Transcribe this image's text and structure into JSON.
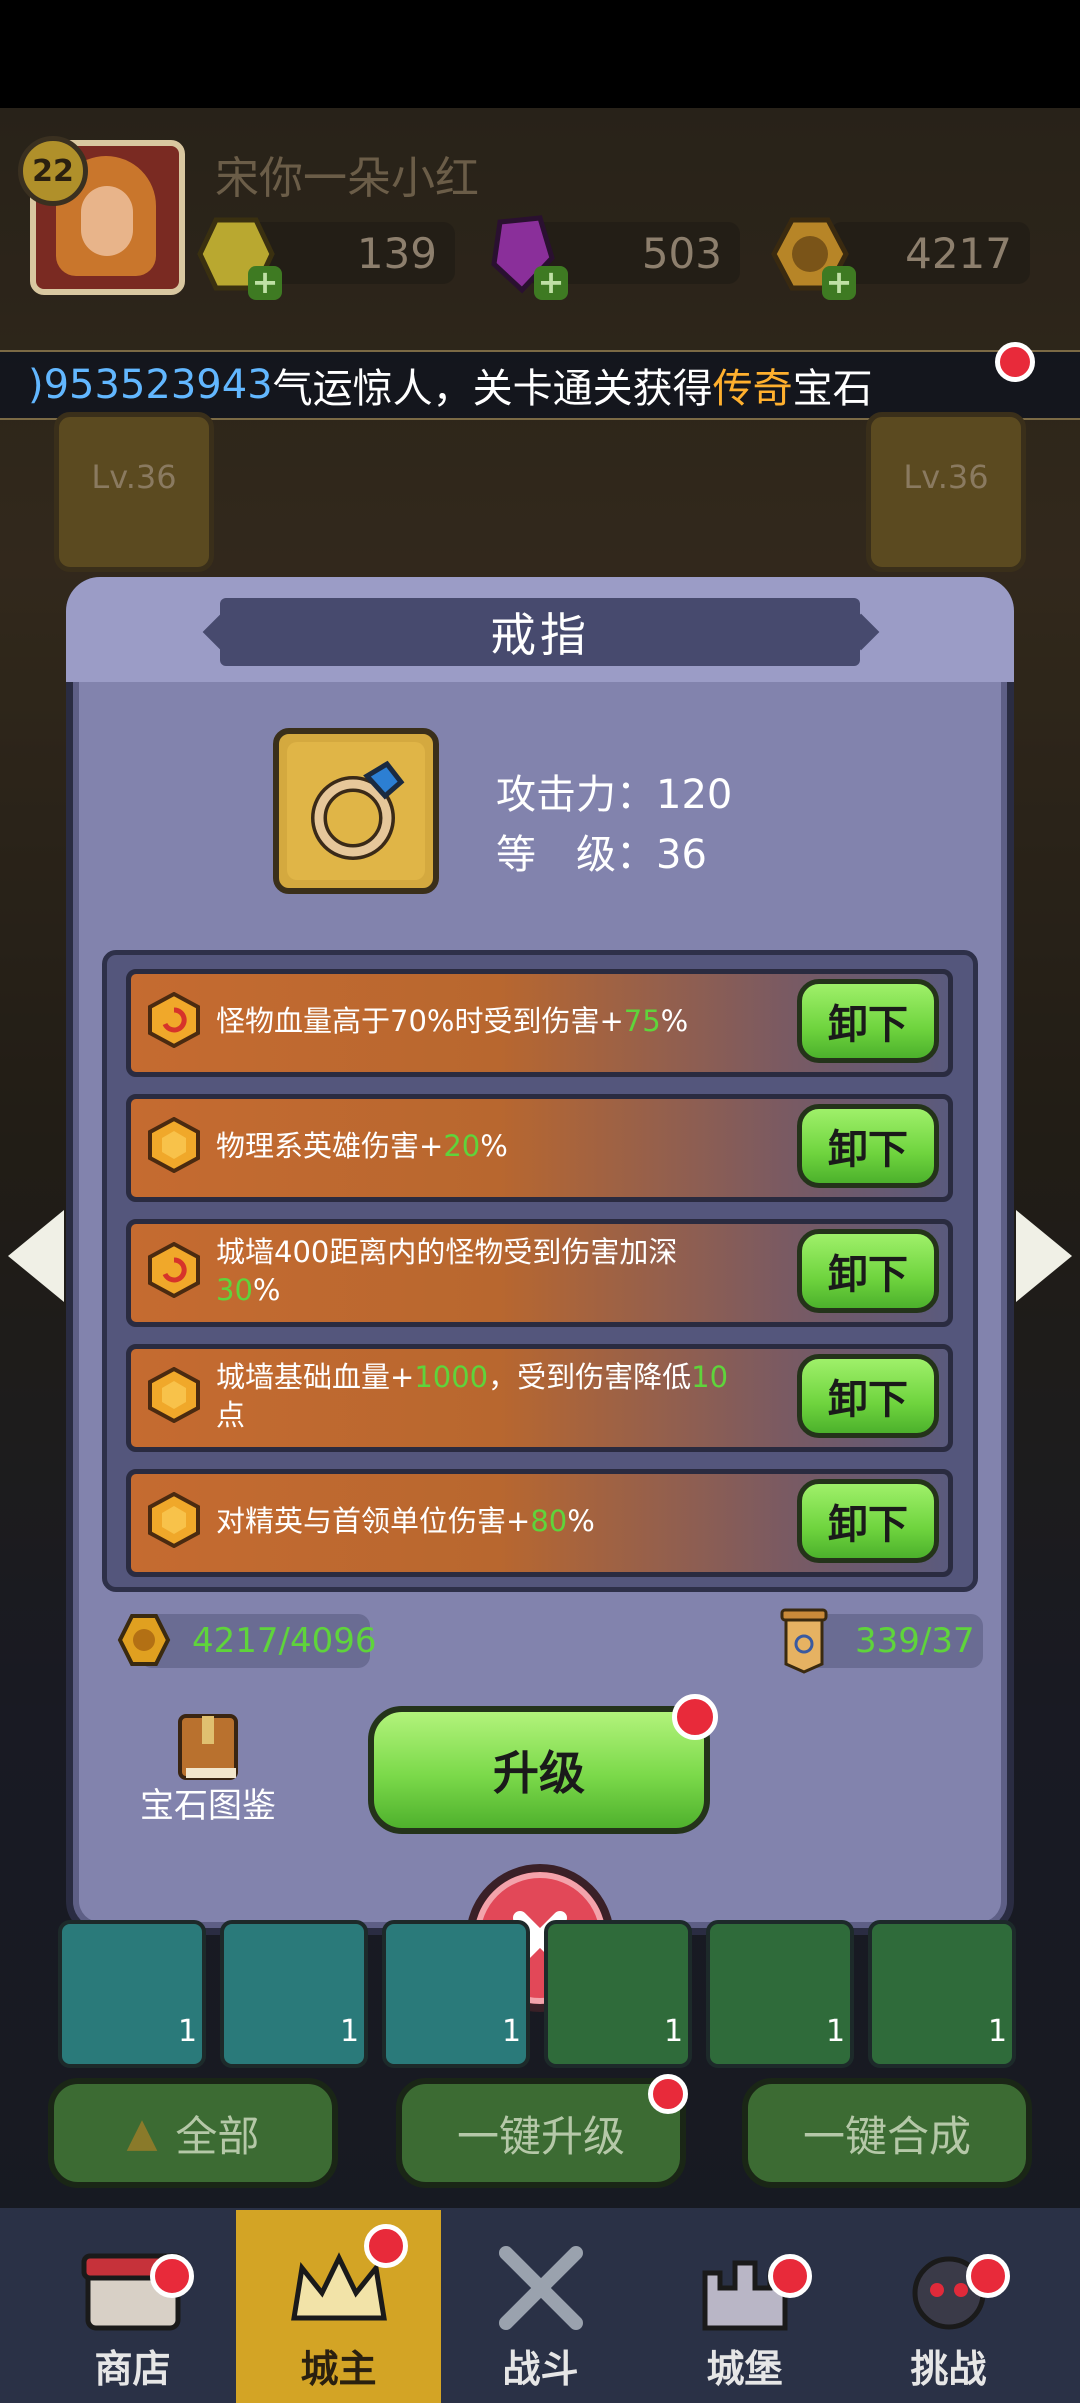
{
  "player": {
    "level": "22",
    "name": "宋你一朵小红"
  },
  "resources": [
    {
      "name": "gold-gem",
      "value": "139",
      "color": "#c8b83a"
    },
    {
      "name": "purple-crystal",
      "value": "503",
      "color": "#a040b0"
    },
    {
      "name": "coin",
      "value": "4217",
      "color": "#d49a2a"
    }
  ],
  "marquee": {
    "number": ")953523943",
    "text1": "气运惊人，关卡通关获得",
    "highlight": "传奇",
    "text2": "宝石"
  },
  "side_slots": {
    "left_level": "Lv.36",
    "right_level": "Lv.36"
  },
  "dialog": {
    "title": "戒指",
    "stats": {
      "attack_label": "攻击力：",
      "attack_value": "120",
      "level_label": "等　级：",
      "level_value": "36"
    },
    "effects": [
      {
        "pre": "怪物血量高于70%时受到伤害+",
        "val": "75",
        "post": "%",
        "pre2": "",
        "button": "卸下",
        "icon": "swirl-gem-icon"
      },
      {
        "pre": "物理系英雄伤害+",
        "val": "20",
        "post": "%",
        "pre2": "",
        "button": "卸下",
        "icon": "hex-gem-icon"
      },
      {
        "pre": "城墙400距离内的怪物受到伤害加深",
        "val": "30",
        "post": "%",
        "pre2": "",
        "button": "卸下",
        "icon": "swirl-gem-icon"
      },
      {
        "pre": "城墙基础血量+",
        "val": "1000",
        "post": "，受到伤害降低",
        "val2": "10",
        "post2": "点",
        "button": "卸下",
        "icon": "hex-gem-icon"
      },
      {
        "pre": "对精英与首领单位伤害+",
        "val": "80",
        "post": "%",
        "pre2": "",
        "button": "卸下",
        "icon": "hex-gem-icon"
      }
    ],
    "coin_counter": "4217/4096",
    "scroll_counter": "339/37",
    "book_label": "宝石图鉴",
    "upgrade_label": "升级"
  },
  "gem_counts": [
    "1",
    "1",
    "1",
    "1",
    "1",
    "1"
  ],
  "bottom_buttons": {
    "all": "全部",
    "upgrade_all": "一键升级",
    "merge_all": "一键合成"
  },
  "nav": [
    "商店",
    "城主",
    "战斗",
    "城堡",
    "挑战"
  ],
  "colors": {
    "accent_green": "#5fd43b",
    "dialog_bg": "#8283ad",
    "gold_text": "#ffb02e",
    "blue_text": "#62b7ff"
  }
}
